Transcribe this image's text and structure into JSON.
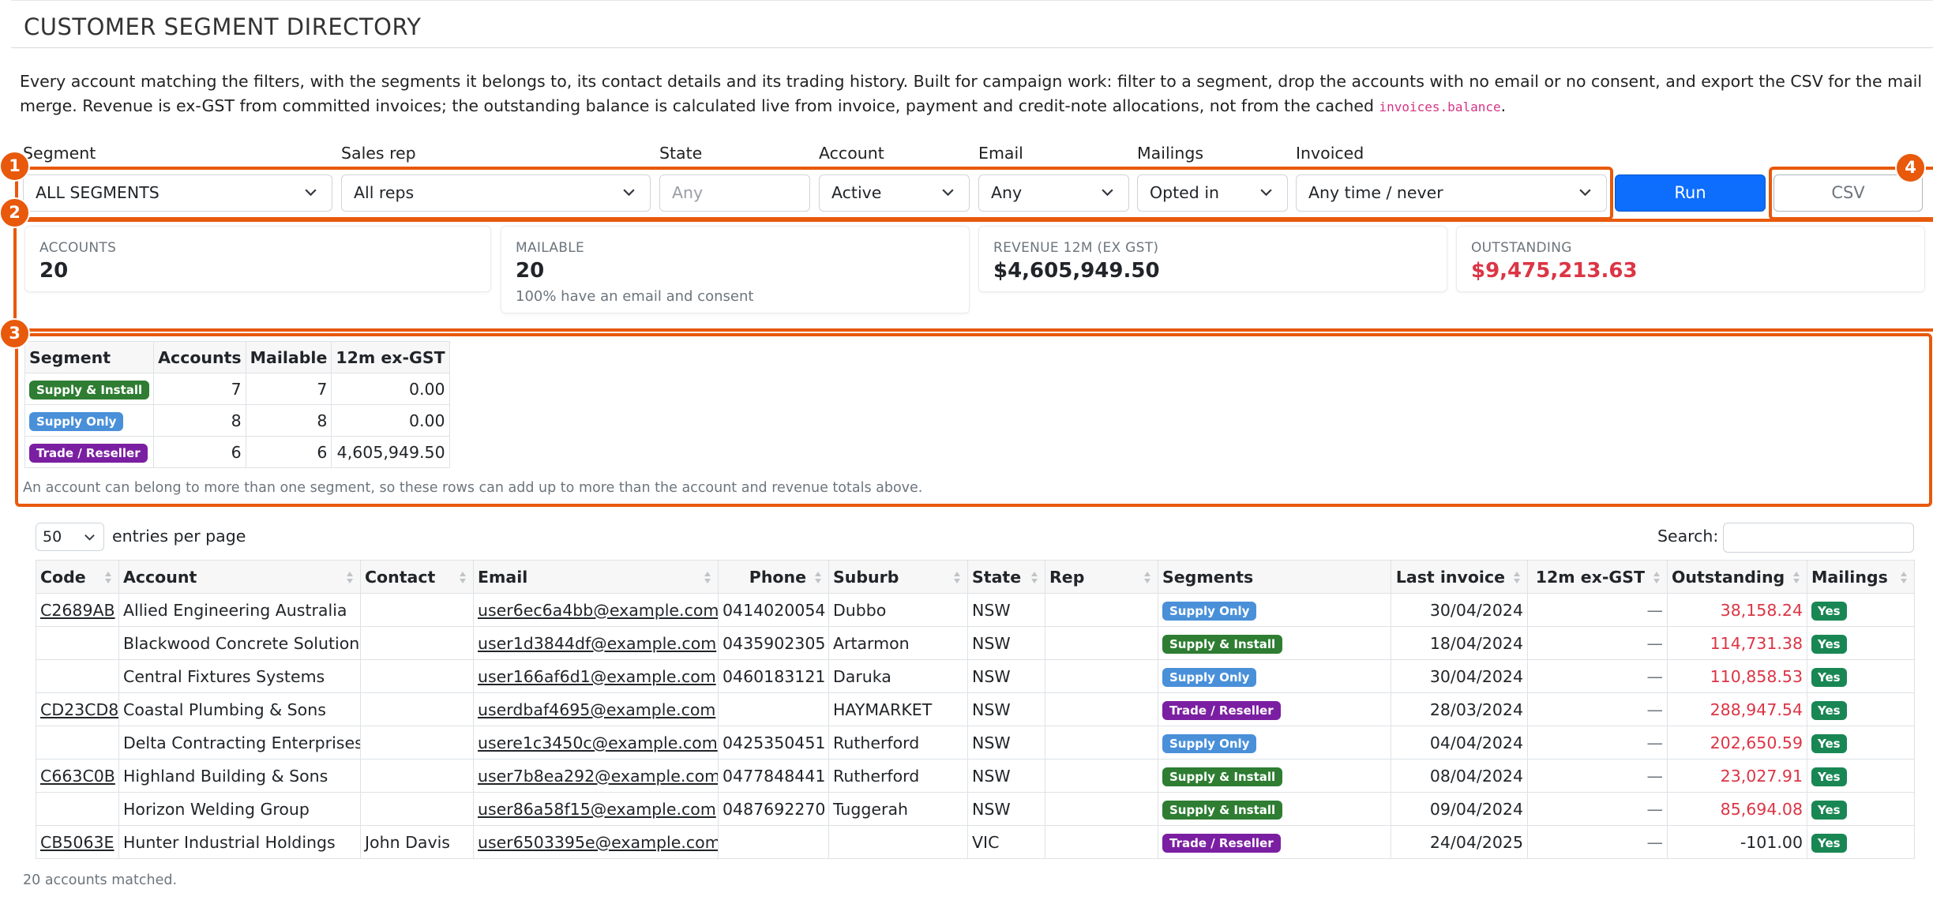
{
  "page": {
    "title": "CUSTOMER SEGMENT DIRECTORY",
    "description_main": "Every account matching the filters, with the segments it belongs to, its contact details and its trading history. Built for campaign work: filter to a segment, drop the accounts with no email or no consent, and export the CSV for the mail merge. Revenue is ex-GST from committed invoices; the outstanding balance is calculated live from invoice, payment and credit-note allocations, not from the cached",
    "description_code": "invoices.balance",
    "description_end": "."
  },
  "filters": {
    "segment": {
      "label": "Segment",
      "value": "ALL SEGMENTS"
    },
    "sales_rep": {
      "label": "Sales rep",
      "value": "All reps"
    },
    "state": {
      "label": "State",
      "placeholder": "Any"
    },
    "account": {
      "label": "Account",
      "value": "Active"
    },
    "email": {
      "label": "Email",
      "value": "Any"
    },
    "mailings": {
      "label": "Mailings",
      "value": "Opted in"
    },
    "invoiced": {
      "label": "Invoiced",
      "value": "Any time / never"
    },
    "run_label": "Run",
    "csv_label": "CSV"
  },
  "summary": {
    "accounts": {
      "label": "ACCOUNTS",
      "value": "20"
    },
    "mailable": {
      "label": "MAILABLE",
      "value": "20",
      "sub": "100% have an email and consent"
    },
    "revenue": {
      "label": "REVENUE 12M (EX GST)",
      "value": "$4,605,949.50"
    },
    "outstanding": {
      "label": "OUTSTANDING",
      "value": "$9,475,213.63",
      "color": "#dc3545"
    }
  },
  "segments": {
    "headers": [
      "Segment",
      "Accounts",
      "Mailable",
      "12m ex-GST"
    ],
    "rows": [
      {
        "segment": "Supply & Install",
        "color": "#2e7d32",
        "accounts": "7",
        "mailable": "7",
        "revenue": "0.00"
      },
      {
        "segment": "Supply Only",
        "color": "#4a90d9",
        "accounts": "8",
        "mailable": "8",
        "revenue": "0.00"
      },
      {
        "segment": "Trade / Reseller",
        "color": "#7b1fa2",
        "accounts": "6",
        "mailable": "6",
        "revenue": "4,605,949.50"
      }
    ],
    "note": "An account can belong to more than one segment, so these rows can add up to more than the account and revenue totals above."
  },
  "markers": [
    "1",
    "2",
    "3",
    "4"
  ],
  "table": {
    "length_value": "50",
    "length_label": "entries per page",
    "search_label": "Search:",
    "headers": [
      "Code",
      "Account",
      "Contact",
      "Email",
      "Phone",
      "Suburb",
      "State",
      "Rep",
      "Segments",
      "Last invoice",
      "12m ex-GST",
      "Outstanding",
      "Mailings"
    ],
    "rows": [
      {
        "code": "C2689AB",
        "account": "Allied Engineering Australia",
        "contact": "",
        "email": "user6ec6a4bb@example.com",
        "phone": "0414020054",
        "suburb": "Dubbo",
        "state": "NSW",
        "rep": "",
        "segment": "Supply Only",
        "seg_color": "#4a90d9",
        "last_invoice": "30/04/2024",
        "revenue": "—",
        "outstanding": "38,158.24",
        "outstanding_red": true,
        "mailings": "Yes"
      },
      {
        "code": "",
        "account": "Blackwood Concrete Solutions",
        "contact": "",
        "email": "user1d3844df@example.com",
        "phone": "0435902305",
        "suburb": "Artarmon",
        "state": "NSW",
        "rep": "",
        "segment": "Supply & Install",
        "seg_color": "#2e7d32",
        "last_invoice": "18/04/2024",
        "revenue": "—",
        "outstanding": "114,731.38",
        "outstanding_red": true,
        "mailings": "Yes"
      },
      {
        "code": "",
        "account": "Central Fixtures Systems",
        "contact": "",
        "email": "user166af6d1@example.com",
        "phone": "0460183121",
        "suburb": "Daruka",
        "state": "NSW",
        "rep": "",
        "segment": "Supply Only",
        "seg_color": "#4a90d9",
        "last_invoice": "30/04/2024",
        "revenue": "—",
        "outstanding": "110,858.53",
        "outstanding_red": true,
        "mailings": "Yes"
      },
      {
        "code": "CD23CD8",
        "account": "Coastal Plumbing & Sons",
        "contact": "",
        "email": "userdbaf4695@example.com",
        "phone": "",
        "suburb": "HAYMARKET",
        "state": "NSW",
        "rep": "",
        "segment": "Trade / Reseller",
        "seg_color": "#7b1fa2",
        "last_invoice": "28/03/2024",
        "revenue": "—",
        "outstanding": "288,947.54",
        "outstanding_red": true,
        "mailings": "Yes"
      },
      {
        "code": "",
        "account": "Delta Contracting Enterprises",
        "contact": "",
        "email": "usere1c3450c@example.com",
        "phone": "0425350451",
        "suburb": "Rutherford",
        "state": "NSW",
        "rep": "",
        "segment": "Supply Only",
        "seg_color": "#4a90d9",
        "last_invoice": "04/04/2024",
        "revenue": "—",
        "outstanding": "202,650.59",
        "outstanding_red": true,
        "mailings": "Yes"
      },
      {
        "code": "C663C0B",
        "account": "Highland Building & Sons",
        "contact": "",
        "email": "user7b8ea292@example.com",
        "phone": "0477848441",
        "suburb": "Rutherford",
        "state": "NSW",
        "rep": "",
        "segment": "Supply & Install",
        "seg_color": "#2e7d32",
        "last_invoice": "08/04/2024",
        "revenue": "—",
        "outstanding": "23,027.91",
        "outstanding_red": true,
        "mailings": "Yes"
      },
      {
        "code": "",
        "account": "Horizon Welding Group",
        "contact": "",
        "email": "user86a58f15@example.com",
        "phone": "0487692270",
        "suburb": "Tuggerah",
        "state": "NSW",
        "rep": "",
        "segment": "Supply & Install",
        "seg_color": "#2e7d32",
        "last_invoice": "09/04/2024",
        "revenue": "—",
        "outstanding": "85,694.08",
        "outstanding_red": true,
        "mailings": "Yes"
      },
      {
        "code": "CB5063E",
        "account": "Hunter Industrial Holdings",
        "contact": "John Davis",
        "email": "user6503395e@example.com",
        "phone": "",
        "suburb": "",
        "state": "VIC",
        "rep": "",
        "segment": "Trade / Reseller",
        "seg_color": "#7b1fa2",
        "last_invoice": "24/04/2025",
        "revenue": "—",
        "outstanding": "-101.00",
        "outstanding_red": false,
        "mailings": "Yes"
      }
    ],
    "footer": "20 accounts matched."
  }
}
